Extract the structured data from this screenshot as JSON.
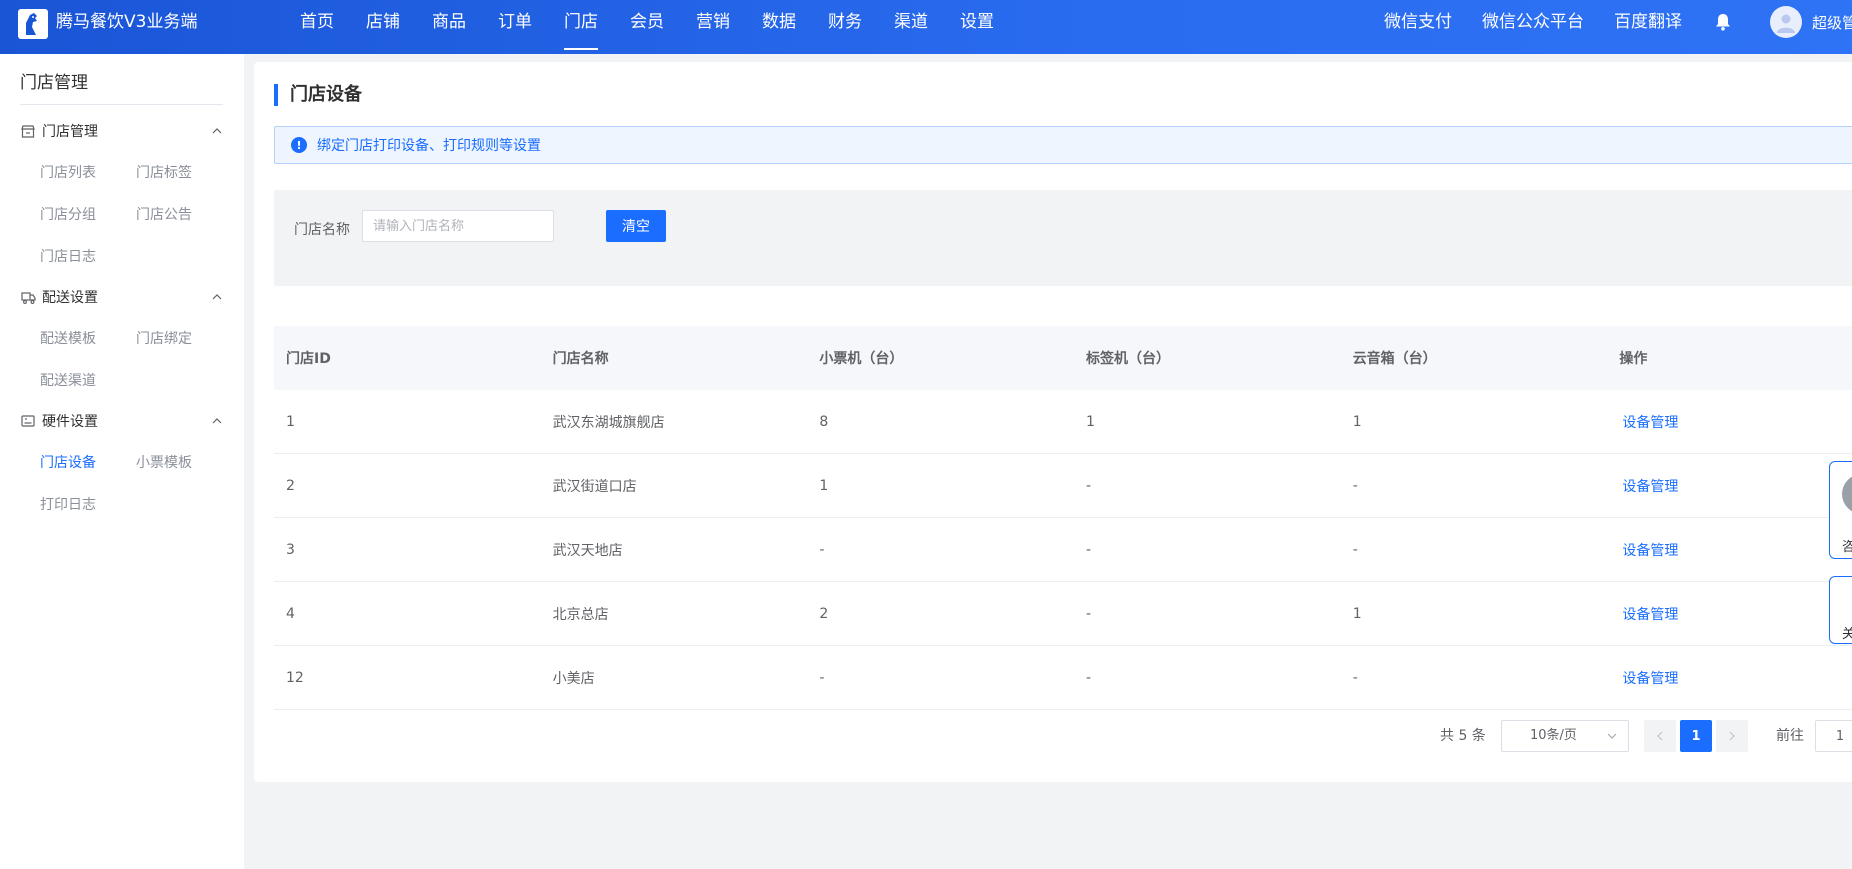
{
  "header": {
    "app_title": "腾马餐饮V3业务端",
    "nav": [
      {
        "label": "首页",
        "active": false
      },
      {
        "label": "店铺",
        "active": false
      },
      {
        "label": "商品",
        "active": false
      },
      {
        "label": "订单",
        "active": false
      },
      {
        "label": "门店",
        "active": true
      },
      {
        "label": "会员",
        "active": false
      },
      {
        "label": "营销",
        "active": false
      },
      {
        "label": "数据",
        "active": false
      },
      {
        "label": "财务",
        "active": false
      },
      {
        "label": "渠道",
        "active": false
      },
      {
        "label": "设置",
        "active": false
      }
    ],
    "right_links": [
      "微信支付",
      "微信公众平台",
      "百度翻译"
    ],
    "user_name": "超级管"
  },
  "sidebar": {
    "title": "门店管理",
    "groups": [
      {
        "label": "门店管理",
        "icon": "store-icon",
        "items": [
          {
            "label": "门店列表",
            "active": false
          },
          {
            "label": "门店标签",
            "active": false
          },
          {
            "label": "门店分组",
            "active": false
          },
          {
            "label": "门店公告",
            "active": false
          },
          {
            "label": "门店日志",
            "active": false
          }
        ]
      },
      {
        "label": "配送设置",
        "icon": "delivery-icon",
        "items": [
          {
            "label": "配送模板",
            "active": false
          },
          {
            "label": "门店绑定",
            "active": false
          },
          {
            "label": "配送渠道",
            "active": false
          }
        ]
      },
      {
        "label": "硬件设置",
        "icon": "hardware-icon",
        "items": [
          {
            "label": "门店设备",
            "active": true
          },
          {
            "label": "小票模板",
            "active": false
          },
          {
            "label": "打印日志",
            "active": false
          }
        ]
      }
    ]
  },
  "main": {
    "page_title": "门店设备",
    "alert_text": "绑定门店打印设备、打印规则等设置",
    "filter": {
      "label": "门店名称",
      "placeholder": "请输入门店名称",
      "value": "",
      "clear_label": "清空"
    },
    "table": {
      "columns": [
        "门店ID",
        "门店名称",
        "小票机（台）",
        "标签机（台）",
        "云音箱（台）",
        "操作"
      ],
      "rows": [
        [
          "1",
          "武汉东湖城旗舰店",
          "8",
          "1",
          "1",
          "设备管理"
        ],
        [
          "2",
          "武汉街道口店",
          "1",
          "-",
          "-",
          "设备管理"
        ],
        [
          "3",
          "武汉天地店",
          "-",
          "-",
          "-",
          "设备管理"
        ],
        [
          "4",
          "北京总店",
          "2",
          "-",
          "1",
          "设备管理"
        ],
        [
          "12",
          "小美店",
          "-",
          "-",
          "-",
          "设备管理"
        ]
      ]
    },
    "pagination": {
      "total_text": "共 5 条",
      "page_size": "10条/页",
      "current_page": "1",
      "goto_label": "前往",
      "goto_value": "1"
    }
  },
  "float_widgets": {
    "first_text": "咨",
    "second_text": "关"
  },
  "colors": {
    "primary": "#1a6dff",
    "header_from": "#1a55d6",
    "header_to": "#2e72f5"
  }
}
